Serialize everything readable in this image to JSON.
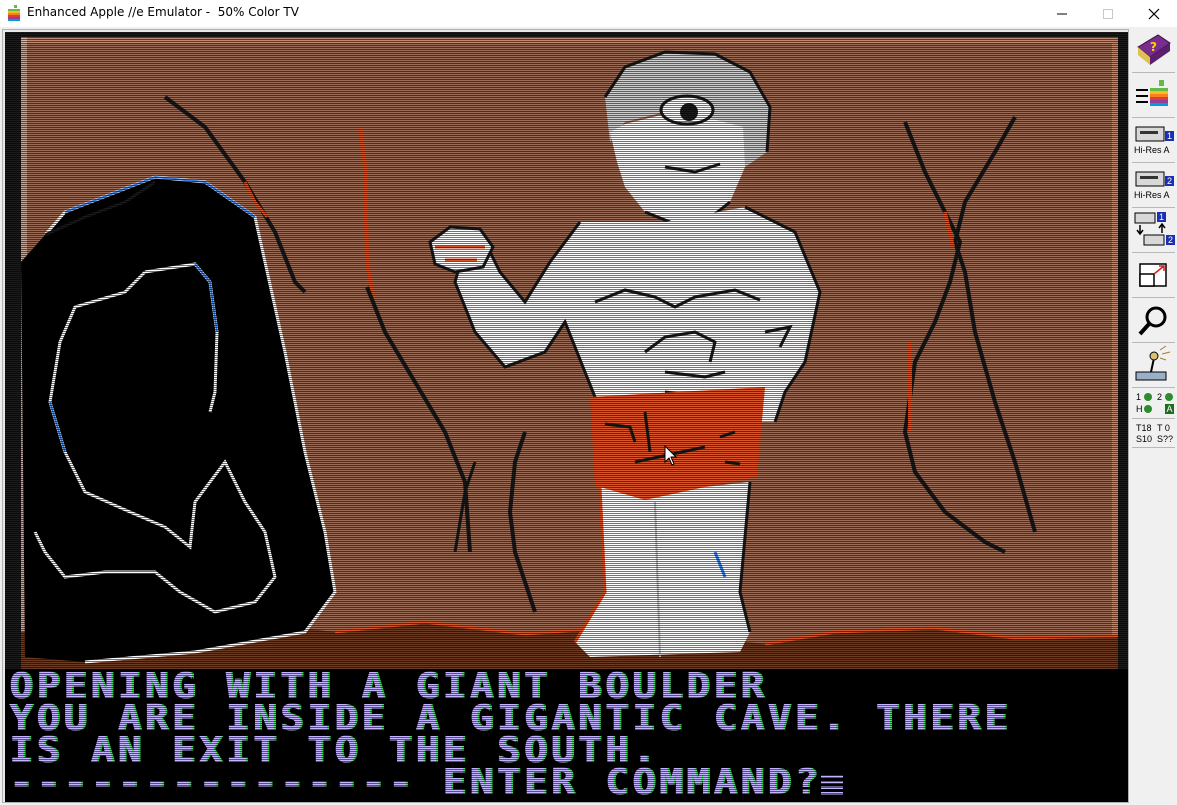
{
  "window": {
    "title": "Enhanced Apple //e Emulator -  50% Color TV",
    "minimize_glyph": "minimize-icon",
    "maximize_glyph": "maximize-icon",
    "close_glyph": "close-icon"
  },
  "screen": {
    "scene": {
      "background_color": "#9a6b56",
      "figure_color": "#ffffff",
      "loincloth_color": "#d9552a",
      "cave_color": "#000000",
      "accent_colors": [
        "#d9552a",
        "#3a7ad8",
        "#ffffff"
      ]
    },
    "text_lines": [
      "OPENING WITH A GIANT BOULDER",
      "YOU ARE INSIDE A GIGANTIC CAVE. THERE",
      "IS AN EXIT TO THE SOUTH.",
      "--------------- ENTER COMMAND?"
    ],
    "text_color": "#c4b4ff",
    "text_fringe_color": "#54d86b"
  },
  "toolbar": {
    "help": {
      "icon": "help-book-icon"
    },
    "setup": {
      "icon": "apple-setup-icon"
    },
    "drive1": {
      "icon": "disk-drive-icon",
      "number": "1",
      "label": "Hi-Res A"
    },
    "drive2": {
      "icon": "disk-drive-icon",
      "number": "2",
      "label": "Hi-Res A"
    },
    "swap": {
      "icon": "swap-drives-icon",
      "num_a": "1",
      "num_b": "2"
    },
    "fullscreen": {
      "icon": "fullscreen-icon"
    },
    "debug": {
      "icon": "magnifier-icon"
    },
    "settings": {
      "icon": "joystick-icon"
    },
    "leds": {
      "l1": "1",
      "l2": "2",
      "l3": "H",
      "l4": "A"
    },
    "track": {
      "t1": "T18",
      "t2": "T 0",
      "s1": "S10",
      "s2": "S??"
    }
  }
}
